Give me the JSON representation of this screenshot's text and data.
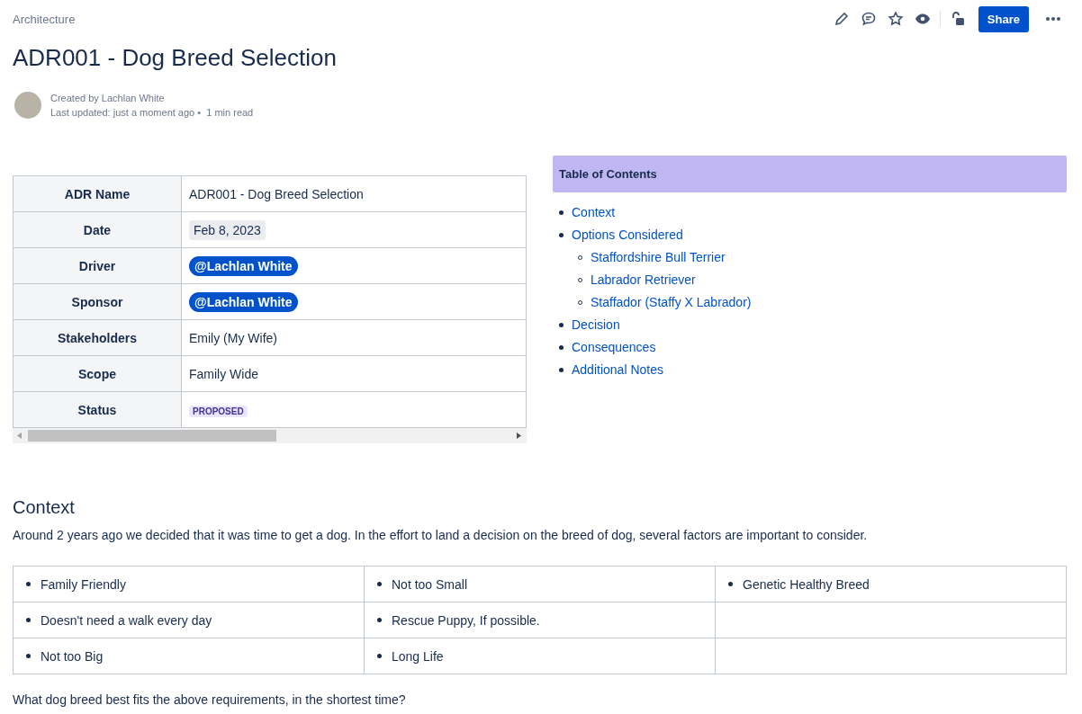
{
  "breadcrumb": "Architecture",
  "toolbar": {
    "share_label": "Share",
    "starred": false
  },
  "title": "ADR001 - Dog Breed Selection",
  "byline": {
    "created": "Created by Lachlan White",
    "updated": "Last updated: just a moment ago",
    "separator": "•",
    "read_time": "1 min read"
  },
  "properties": [
    {
      "label": "ADR Name",
      "kind": "text",
      "value": "ADR001 - Dog Breed Selection"
    },
    {
      "label": "Date",
      "kind": "date",
      "value": "Feb 8, 2023"
    },
    {
      "label": "Driver",
      "kind": "mention",
      "value": "@Lachlan White"
    },
    {
      "label": "Sponsor",
      "kind": "mention",
      "value": "@Lachlan White"
    },
    {
      "label": "Stakeholders",
      "kind": "text",
      "value": "Emily (My Wife)"
    },
    {
      "label": "Scope",
      "kind": "text",
      "value": "Family Wide"
    },
    {
      "label": "Status",
      "kind": "status",
      "value": "PROPOSED"
    }
  ],
  "toc": {
    "title": "Table of Contents",
    "items": [
      {
        "label": "Context"
      },
      {
        "label": "Options Considered",
        "children": [
          {
            "label": "Staffordshire Bull Terrier"
          },
          {
            "label": "Labrador Retriever"
          },
          {
            "label": "Staffador (Staffy X Labrador)"
          }
        ]
      },
      {
        "label": "Decision"
      },
      {
        "label": "Consequences"
      },
      {
        "label": "Additional Notes"
      }
    ]
  },
  "context": {
    "heading": "Context",
    "intro": "Around 2 years ago we decided that it was time to get a dog. In the effort to land a decision on the breed of dog, several factors are important to consider.",
    "requirement_columns": [
      [
        "Family Friendly",
        "Doesn't need a walk every day",
        "Not too Big"
      ],
      [
        "Not too Small",
        "Rescue Puppy, If possible.",
        "Long Life"
      ],
      [
        "Genetic Healthy Breed"
      ]
    ],
    "question": "What dog breed best fits the above requirements, in the shortest time?"
  }
}
